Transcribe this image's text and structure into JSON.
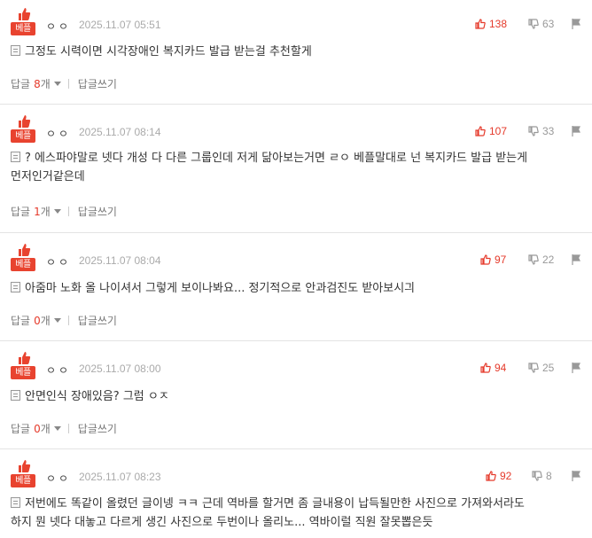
{
  "labels": {
    "best": "베플",
    "reply": "답글",
    "count_unit": "개",
    "write_reply": "답글쓰기"
  },
  "colors": {
    "accent": "#e8432f",
    "up": "#e53a2b",
    "down": "#999999"
  },
  "comments": [
    {
      "nick": "ㅇㅇ",
      "date": "2025.11.07 05:51",
      "up": "138",
      "down": "63",
      "lines": [
        "그정도 시력이면 시각장애인 복지카드 발급 받는걸 추천할게"
      ],
      "reply_count": "8"
    },
    {
      "nick": "ㅇㅇ",
      "date": "2025.11.07 08:14",
      "up": "107",
      "down": "33",
      "lines": [
        "? 에스파야말로 넷다 개성 다 다른 그룹인데 저게 닮아보는거면 ㄹㅇ 베플말대로 넌 복지카드 발급 받는게",
        "먼저인거같은데"
      ],
      "reply_count": "1"
    },
    {
      "nick": "ㅇㅇ",
      "date": "2025.11.07 08:04",
      "up": "97",
      "down": "22",
      "lines": [
        "아줌마 노화 올 나이셔서 그렇게 보이나봐요... 정기적으로 안과검진도 받아보시긔"
      ],
      "reply_count": "0"
    },
    {
      "nick": "ㅇㅇ",
      "date": "2025.11.07 08:00",
      "up": "94",
      "down": "25",
      "lines": [
        "안면인식 장애있음? 그럼 ㅇㅈ"
      ],
      "reply_count": "0"
    },
    {
      "nick": "ㅇㅇ",
      "date": "2025.11.07 08:23",
      "up": "92",
      "down": "8",
      "lines": [
        "저번에도 똑같이 올렸던 글이넹 ㅋㅋ 근데 역바를 할거면 좀 글내용이 납득될만한 사진으로 가져와서라도",
        "하지 뭔 넷다 대놓고 다르게 생긴 사진으로 두번이나 올리노... 역바이럴 직원 잘못뽑은듯"
      ],
      "reply_count": null
    }
  ]
}
